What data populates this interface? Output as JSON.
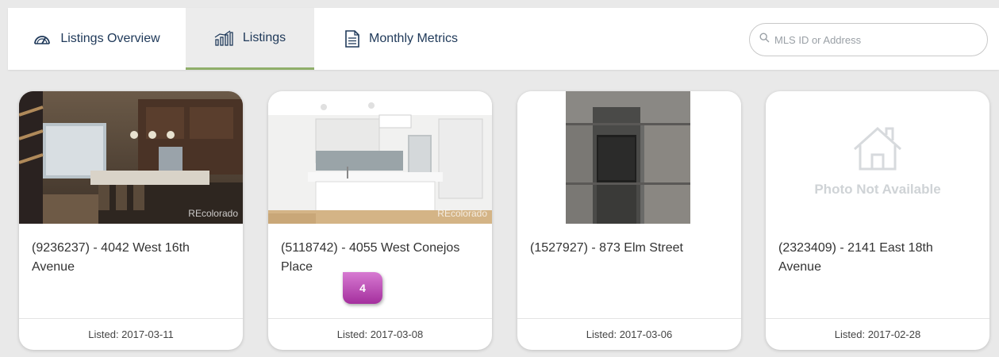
{
  "tabs": {
    "overview": "Listings Overview",
    "listings": "Listings",
    "metrics": "Monthly Metrics"
  },
  "search": {
    "placeholder": "MLS ID or Address"
  },
  "listings": [
    {
      "title": "(9236237) - 4042 West 16th Avenue",
      "listed": "Listed: 2017-03-11",
      "watermark": "REcolorado"
    },
    {
      "title": "(5118742) - 4055 West Conejos Place",
      "listed": "Listed: 2017-03-08",
      "watermark": "REcolorado"
    },
    {
      "title": "(1527927) - 873 Elm Street",
      "listed": "Listed: 2017-03-06"
    },
    {
      "title": "(2323409) - 2141 East 18th Avenue",
      "listed": "Listed: 2017-02-28",
      "photo_placeholder": "Photo Not Available"
    }
  ],
  "callout": {
    "label": "4"
  },
  "colors": {
    "accent": "#8fae6a",
    "nav_text": "#203a5a",
    "badge": "#b84bb1"
  }
}
